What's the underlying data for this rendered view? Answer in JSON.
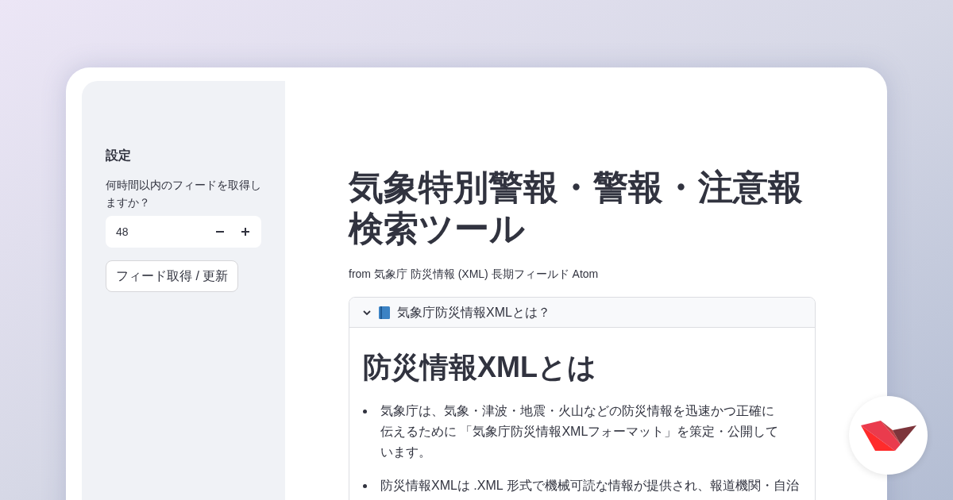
{
  "sidebar": {
    "title": "設定",
    "number_input": {
      "label": "何時間以内のフィードを取得しますか？",
      "value": "48"
    },
    "button": "フィード取得 / 更新"
  },
  "main": {
    "title": "気象特別警報・警報・注意報検索ツール",
    "subtitle": "from 気象庁 防災情報 (XML) 長期フィールド Atom",
    "expander": {
      "label": "気象庁防災情報XMLとは？",
      "expanded": true,
      "heading": "防災情報XMLとは",
      "bullets": [
        "気象庁は、気象・津波・地震・火山などの防災情報を迅速かつ正確に伝えるために 「気象庁防災情報XMLフォーマット」を策定・公開しています。",
        "防災情報XMLは .XML 形式で機械可読な情報が提供され、報道機関・自治"
      ]
    }
  }
}
